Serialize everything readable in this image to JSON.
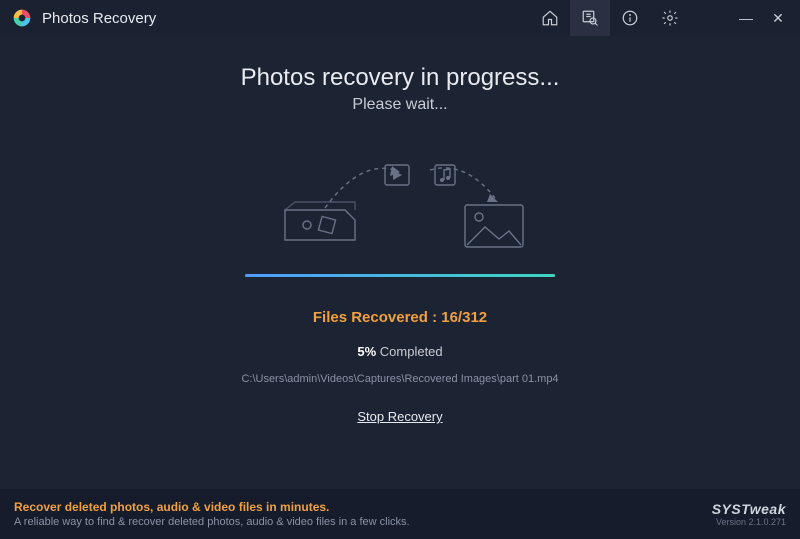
{
  "app": {
    "title": "Photos Recovery"
  },
  "main": {
    "heading": "Photos recovery in progress...",
    "subheading": "Please wait...",
    "files_label": "Files Recovered : 16/312",
    "percent": "5%",
    "percent_suffix": " Completed",
    "path": "C:\\Users\\admin\\Videos\\Captures\\Recovered Images\\part 01.mp4",
    "stop": "Stop Recovery",
    "progress_pct": 100
  },
  "footer": {
    "promo_heading": "Recover deleted photos, audio & video files in minutes.",
    "promo_sub": "A reliable way to find & recover deleted photos, audio & video files in a few clicks.",
    "brand": "SYSTweak",
    "version": "Version 2.1.0.271"
  }
}
